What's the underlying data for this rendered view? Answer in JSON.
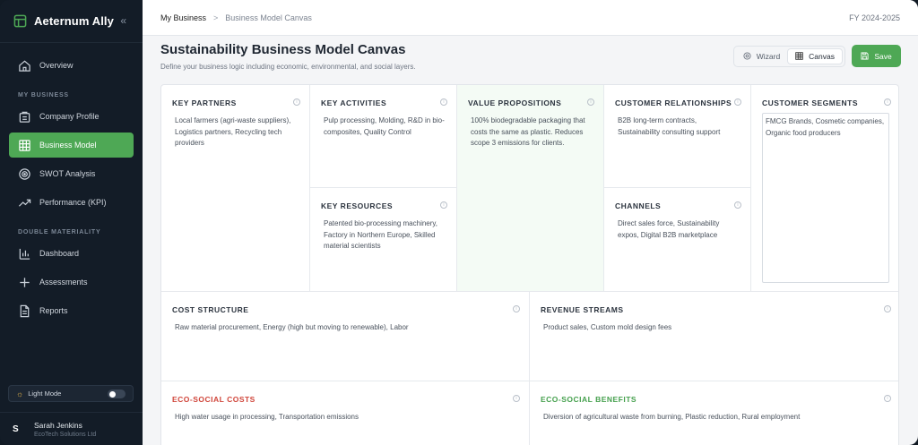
{
  "app": {
    "name": "Aeternum Ally",
    "collapse_icon": "«"
  },
  "sidebar": {
    "top_items": [
      {
        "label": "Overview",
        "icon": "home-icon"
      }
    ],
    "section_my_business": "MY BUSINESS",
    "my_business": [
      {
        "label": "Company Profile",
        "icon": "building-icon"
      },
      {
        "label": "Business Model",
        "icon": "grid-icon",
        "active": true
      },
      {
        "label": "SWOT Analysis",
        "icon": "target-icon"
      },
      {
        "label": "Performance (KPI)",
        "icon": "trend-icon"
      }
    ],
    "section_materiality": "DOUBLE MATERIALITY",
    "materiality": [
      {
        "label": "Dashboard",
        "icon": "bar-chart-icon"
      },
      {
        "label": "Assessments",
        "icon": "plus-icon"
      },
      {
        "label": "Reports",
        "icon": "document-icon"
      }
    ],
    "theme_label": "Light Mode",
    "user": {
      "initial": "S",
      "name": "Sarah Jenkins",
      "org": "EcoTech Solutions Ltd"
    }
  },
  "breadcrumb": {
    "parent": "My Business",
    "current": "Business Model Canvas"
  },
  "fiscal_year": "FY 2024-2025",
  "page": {
    "title": "Sustainability Business Model Canvas",
    "subtitle": "Define your business logic including economic, environmental, and social layers."
  },
  "toolbar": {
    "wizard": "Wizard",
    "canvas": "Canvas",
    "save": "Save"
  },
  "canvas": {
    "key_partners": {
      "title": "KEY PARTNERS",
      "text": "Local farmers (agri-waste suppliers), Logistics partners, Recycling tech providers"
    },
    "key_activities": {
      "title": "KEY ACTIVITIES",
      "text": "Pulp processing, Molding, R&D in bio-composites, Quality Control"
    },
    "key_resources": {
      "title": "KEY RESOURCES",
      "text": "Patented bio-processing machinery, Factory in Northern Europe, Skilled material scientists"
    },
    "value_propositions": {
      "title": "VALUE PROPOSITIONS",
      "text": "100% biodegradable packaging that costs the same as plastic. Reduces scope 3 emissions for clients."
    },
    "customer_relationships": {
      "title": "CUSTOMER RELATIONSHIPS",
      "text": "B2B long-term contracts, Sustainability consulting support"
    },
    "channels": {
      "title": "CHANNELS",
      "text": "Direct sales force, Sustainability expos, Digital B2B marketplace"
    },
    "customer_segments": {
      "title": "CUSTOMER SEGMENTS",
      "text": "FMCG Brands, Cosmetic companies, Organic food producers"
    },
    "cost_structure": {
      "title": "COST STRUCTURE",
      "text": "Raw material procurement, Energy (high but moving to renewable), Labor"
    },
    "revenue_streams": {
      "title": "REVENUE STREAMS",
      "text": "Product sales, Custom mold design fees"
    },
    "eco_social_costs": {
      "title": "ECO-SOCIAL COSTS",
      "text": "High water usage in processing, Transportation emissions"
    },
    "eco_social_benefits": {
      "title": "ECO-SOCIAL BENEFITS",
      "text": "Diversion of agricultural waste from burning, Plastic reduction, Rural employment"
    }
  },
  "colors": {
    "accent": "#4ea855",
    "sidebar_bg": "#131c27",
    "cost_red": "#d0453a",
    "benefit_green": "#45a04d"
  }
}
